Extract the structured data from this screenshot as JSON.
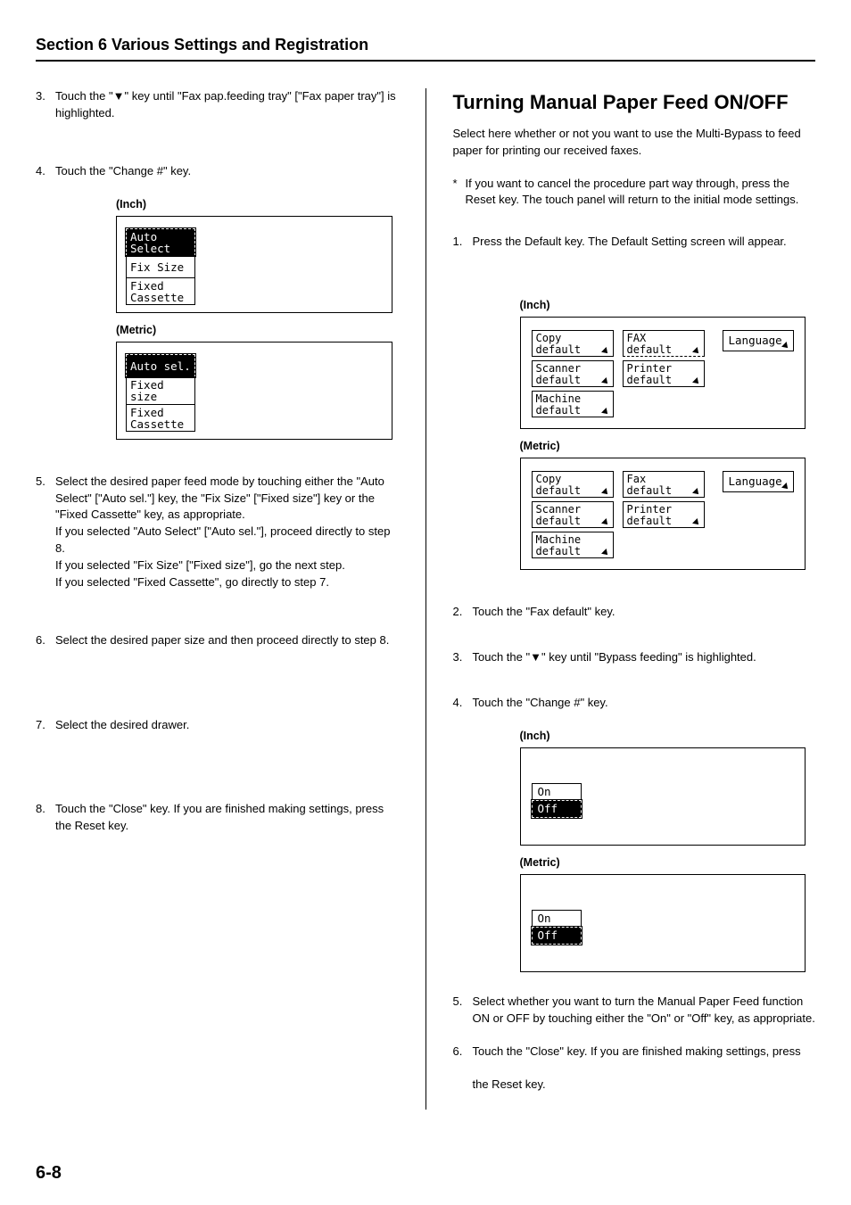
{
  "header": "Section 6  Various Settings and Registration",
  "pageNumber": "6-8",
  "left": {
    "step3": "Touch the \"▼\" key until \"Fax pap.feeding tray\" [\"Fax paper tray\"] is highlighted.",
    "step4": "Touch the \"Change #\" key.",
    "inchLabel": "(Inch)",
    "metricLabel": "(Metric)",
    "inchPanel": {
      "opts": [
        "Auto\nSelect",
        "Fix Size",
        "Fixed\nCassette"
      ]
    },
    "metricPanel": {
      "opts": [
        "Auto sel.",
        "Fixed size",
        "Fixed\nCassette"
      ]
    },
    "step5": "Select the desired paper feed mode by touching either the \"Auto Select\" [\"Auto sel.\"] key, the \"Fix Size\" [\"Fixed size\"] key or the \"Fixed Cassette\" key, as appropriate.\nIf you selected \"Auto Select\" [\"Auto sel.\"], proceed directly to step 8.\nIf you selected \"Fix Size\" [\"Fixed size\"], go the next step.\nIf you selected \"Fixed Cassette\", go directly to step 7.",
    "step6": "Select the desired paper size and then proceed directly to step 8.",
    "step7": "Select the desired drawer.",
    "step8": "Touch the \"Close\" key. If you are finished making settings, press the Reset key."
  },
  "right": {
    "title": "Turning Manual Paper Feed ON/OFF",
    "intro": "Select here whether or not you want to use the Multi-Bypass to feed paper for printing our received faxes.",
    "note": "If you want to cancel the procedure part way through, press the Reset key. The touch panel will return to the initial mode settings.",
    "step1": "Press the Default key. The Default Setting screen will appear.",
    "inchLabel": "(Inch)",
    "metricLabel": "(Metric)",
    "defaultsInch": {
      "copy": "Copy\ndefault",
      "fax": "FAX\ndefault",
      "scanner": "Scanner\ndefault",
      "printer": "Printer\ndefault",
      "machine": "Machine\ndefault",
      "lang": "Language"
    },
    "defaultsMetric": {
      "copy": "Copy\ndefault",
      "fax": "Fax\ndefault",
      "scanner": "Scanner\ndefault",
      "printer": "Printer\ndefault",
      "machine": "Machine\ndefault",
      "lang": "Language"
    },
    "step2": "Touch the \"Fax default\" key.",
    "step3": "Touch the \"▼\" key until \"Bypass feeding\" is highlighted.",
    "step4": "Touch the \"Change #\" key.",
    "onoff": {
      "on": "On",
      "off": "Off"
    },
    "step5": "Select whether you want to turn the Manual Paper Feed function ON or OFF by touching either the \"On\" or \"Off\" key, as appropriate.",
    "step6a": "Touch the \"Close\" key. If you are finished making settings, press",
    "step6b": "the Reset key."
  }
}
